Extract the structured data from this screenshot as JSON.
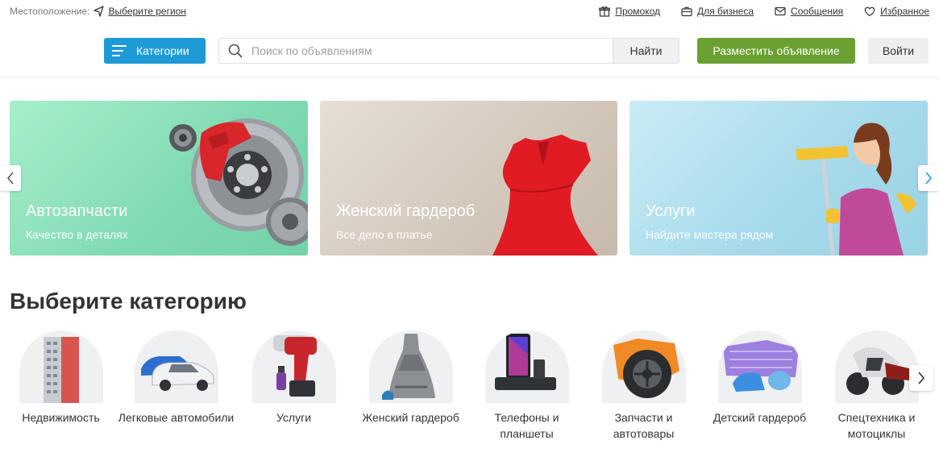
{
  "topbar": {
    "location_label": "Местоположение:",
    "region_link": "Выберите регион",
    "links": [
      {
        "label": "Промокод",
        "icon": "gift-icon"
      },
      {
        "label": "Для бизнеса",
        "icon": "briefcase-icon"
      },
      {
        "label": "Сообщения",
        "icon": "mail-icon"
      },
      {
        "label": "Избранное",
        "icon": "heart-icon"
      }
    ]
  },
  "header": {
    "categories_label": "Категории",
    "search_placeholder": "Поиск по объявлениям",
    "search_value": "",
    "find_label": "Найти",
    "post_label": "Разместить объявление",
    "login_label": "Войти"
  },
  "banners": [
    {
      "title": "Автозапчасти",
      "subtitle": "Качество в деталях"
    },
    {
      "title": "Женский гардероб",
      "subtitle": "Все дело в платье"
    },
    {
      "title": "Услуги",
      "subtitle": "Найдите мастера рядом"
    }
  ],
  "categories": {
    "heading": "Выберите категорию",
    "items": [
      {
        "label": "Недвижимость"
      },
      {
        "label": "Легковые автомобили"
      },
      {
        "label": "Услуги"
      },
      {
        "label": "Женский гардероб"
      },
      {
        "label": "Телефоны и планшеты"
      },
      {
        "label": "Запчасти и автотовары"
      },
      {
        "label": "Детский гардероб"
      },
      {
        "label": "Спецтехника и мотоциклы"
      }
    ]
  },
  "colors": {
    "primary_blue": "#1e9ad6",
    "post_green": "#6ba132",
    "text": "#333333"
  }
}
